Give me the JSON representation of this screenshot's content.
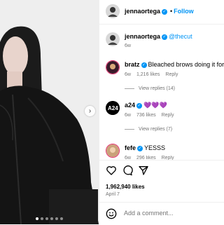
{
  "post": {
    "author": "jennaortega",
    "follow_label": "Follow",
    "separator": "•",
    "verified_glyph": "✓",
    "caption_tag": "@thecut",
    "caption_age": "6w",
    "likes": "1,962,940 likes",
    "date": "April 7",
    "carousel_next_glyph": "›",
    "carousel_dot_count": 6
  },
  "comments": [
    {
      "user": "bratz",
      "text": "Bleached brows doing it for us",
      "age": "6w",
      "likes": "1,216 likes",
      "reply": "Reply",
      "view_replies": "View replies (14)"
    },
    {
      "user": "a24",
      "text": "💜💜💜",
      "age": "6w",
      "likes": "736 likes",
      "reply": "Reply",
      "view_replies": "View replies (7)"
    },
    {
      "user": "fefe",
      "text": "YESSS",
      "age": "6w",
      "likes": "296 likes",
      "reply": "Reply"
    }
  ],
  "comment_input": {
    "placeholder": "Add a comment..."
  },
  "colors": {
    "accent": "#0095f6",
    "muted": "#737373",
    "heart": "#e1306c"
  },
  "icons": [
    "heart-icon",
    "comment-icon",
    "share-icon",
    "emoji-icon",
    "chevron-right-icon",
    "verified-icon"
  ]
}
